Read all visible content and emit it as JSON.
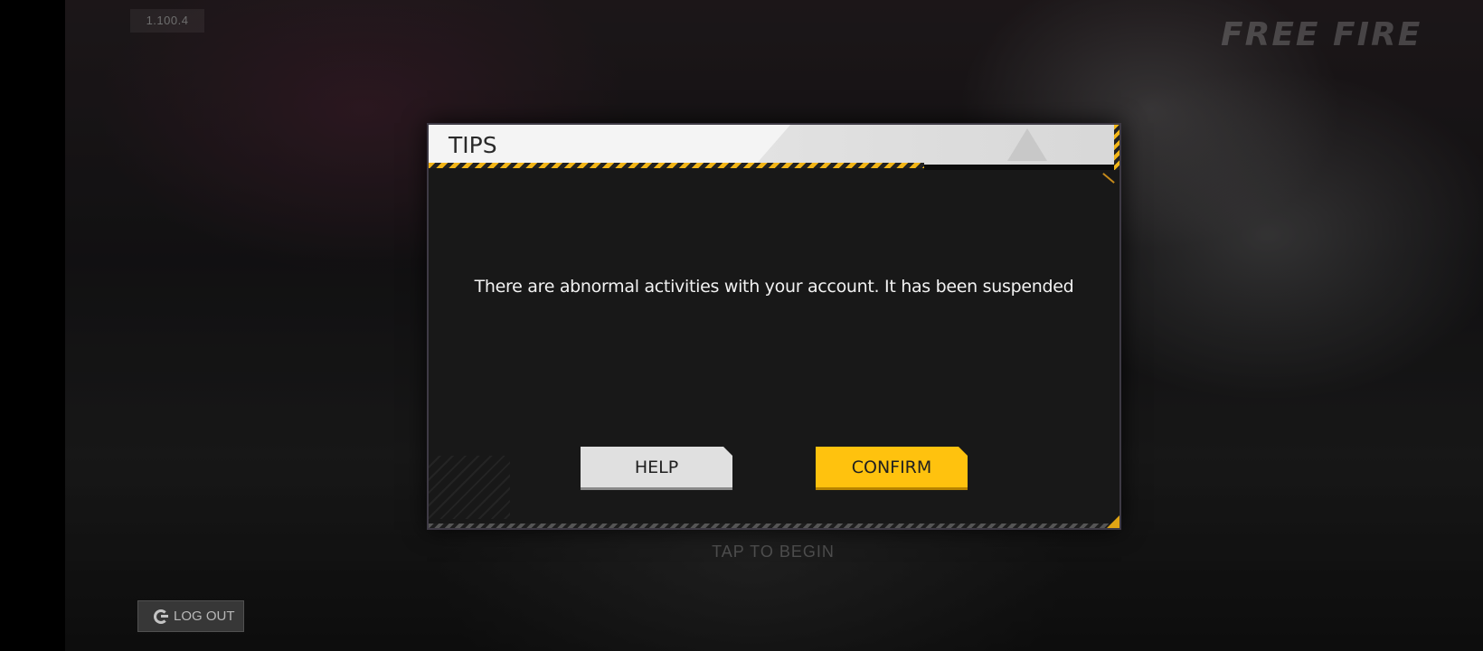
{
  "game": {
    "version": "1.100.4",
    "logo_text": "FREE FIRE",
    "tap_prompt": "TAP TO BEGIN",
    "logout_label": "LOG OUT",
    "logout_icon": "google-g-icon"
  },
  "dialog": {
    "title": "TIPS",
    "message": "There are abnormal activities with your account. It has been suspended",
    "help_label": "HELP",
    "confirm_label": "CONFIRM"
  },
  "colors": {
    "accent_yellow": "#ffc20e",
    "dialog_bg": "#181818",
    "header_bg": "#f4f4f4",
    "help_button_bg": "#e0e0e0"
  }
}
